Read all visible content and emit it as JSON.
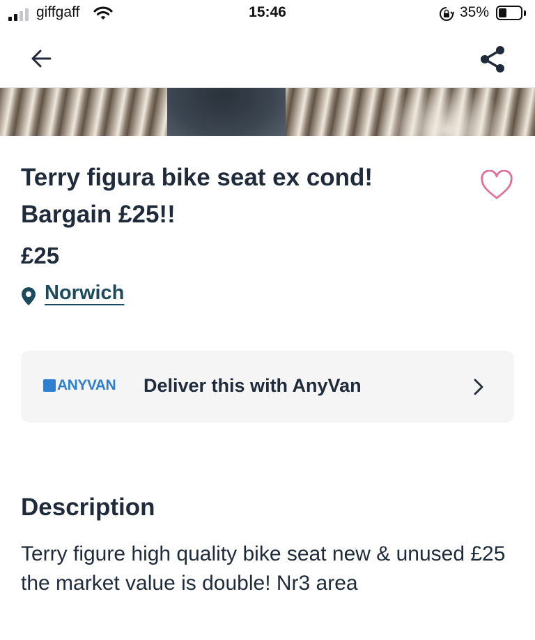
{
  "status_bar": {
    "carrier": "giffgaff",
    "time": "15:46",
    "battery_percent": "35%",
    "battery_level": 0.35
  },
  "nav": {
    "back_icon": "arrow-left-icon",
    "share_icon": "share-icon"
  },
  "listing": {
    "title": "Terry figura bike seat ex cond! Bargain £25!!",
    "price": "£25",
    "location": "Norwich",
    "favorite_icon": "heart-outline-icon",
    "favorite_color": "#e0709b"
  },
  "delivery": {
    "logo_text": "ANYVAN",
    "label": "Deliver this with AnyVan",
    "logo_color": "#2e7fd0"
  },
  "description": {
    "heading": "Description",
    "body": "Terry figure high quality bike seat new & unused £25 the market value is double! Nr3 area"
  },
  "colors": {
    "text": "#1f2b3a",
    "link": "#1d4b5e",
    "card_bg": "#f5f5f6"
  }
}
